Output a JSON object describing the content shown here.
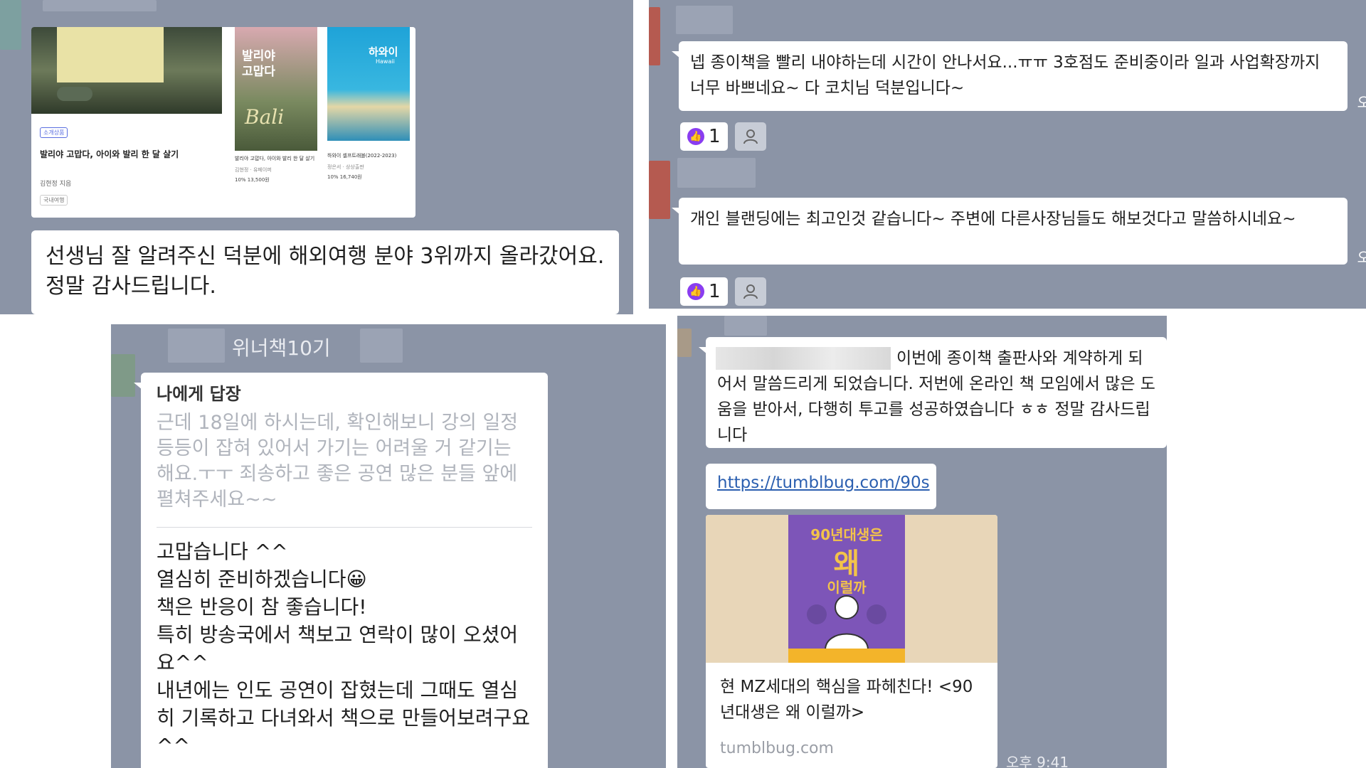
{
  "panel1": {
    "card": {
      "badge": "소개상품",
      "title": "발리야 고맙다, 아이와 발리 한 달 살기",
      "author": "김현정 지음",
      "chip": "국내여행",
      "book1": {
        "cover_title": "발리야 고맙다",
        "cover_sub": "Bali",
        "title": "발리야 고맙다, 아이와 발리 한 달 살기",
        "meta": "김현정 · 유페이퍼",
        "price": "10% 13,500원"
      },
      "book2": {
        "cover_title": "하와이",
        "cover_sub": "Hawaii",
        "title": "하와이 셀프트래블(2022-2023)",
        "meta": "정은서 · 상상출판",
        "price": "10% 16,740원"
      }
    },
    "message": "선생님 잘 알려주신 덕분에 해외여행 분야 3위까지 올라갔어요. 정말 감사드립니다."
  },
  "panel2": {
    "messages": [
      {
        "text": "넵 종이책을 빨리 내야하는데 시간이 안나서요...ㅠㅠ 3호점도 준비중이라 일과 사업확장까지 너무 바쁘네요~ 다 코치님 덕분입니다~",
        "like_count": "1",
        "time": "오"
      },
      {
        "text": "개인 블랜딩에는 최고인것 같습니다~ 주변에 다른사장님들도 해보것다고 말씀하시네요~",
        "like_count": "1",
        "time": "오"
      }
    ]
  },
  "panel3": {
    "header": "위너책10기",
    "reply_label": "나에게 답장",
    "quoted": "근데 18일에 하시는데, 확인해보니 강의 일정 등등이 잡혀 있어서 가기는 어려울 거 같기는 해요.ㅜㅜ 죄송하고 좋은 공연 많은 분들 앞에 펼쳐주세요~~",
    "reply_lines": [
      "고맙습니다 ^^",
      "열심히 준비하겠습니다😀",
      "책은 반응이 참 좋습니다!",
      "특히 방송국에서 책보고 연락이 많이 오셨어요^^",
      "내년에는 인도 공연이 잡혔는데 그때도 열심히 기록하고 다녀와서 책으로 만들어보려구요^^"
    ]
  },
  "panel4": {
    "message": "이번에 종이책 출판사와 계약하게 되어서 말씀드리게 되었습니다. 저번에 온라인 책 모임에서 많은 도움을 받아서, 다행히 투고를 성공하였습니다 ㅎㅎ 정말 감사드립니다",
    "link": "https://tumblbug.com/90s",
    "preview": {
      "cover_title_1": "90년대생은",
      "cover_title_2": "왜",
      "cover_title_3": "이럴까",
      "description": "현 MZ세대의 핵심을 파헤친다! <90년대생은 왜 이럴까>",
      "domain": "tumblbug.com"
    },
    "time": "오후 9:41"
  },
  "colors": {
    "chat_bg": "#8b94a6",
    "bubble": "#ffffff",
    "like": "#8a3df0",
    "link": "#2b5fb0"
  }
}
